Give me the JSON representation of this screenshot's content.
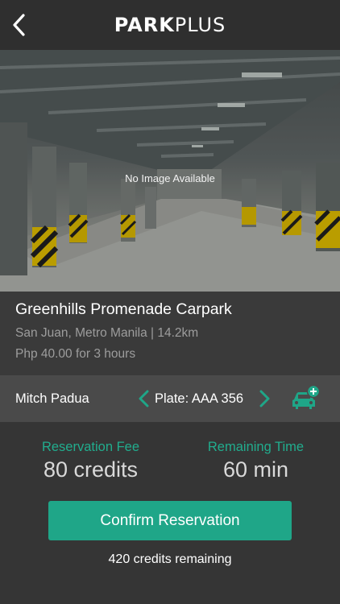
{
  "header": {
    "logo_bold": "PARK",
    "logo_light": "PLUS",
    "back_icon": "chevron-left-icon"
  },
  "hero": {
    "placeholder_text": "No Image Available"
  },
  "venue": {
    "name": "Greenhills Promenade Carpark",
    "location": "San Juan, Metro Manila | 14.2km",
    "rate": "Php 40.00 for 3 hours"
  },
  "vehicle": {
    "user_name": "Mitch Padua",
    "plate_label": "Plate: AAA 356",
    "prev_icon": "chevron-left-icon",
    "next_icon": "chevron-right-icon",
    "add_icon": "add-car-icon"
  },
  "stats": {
    "fee_label": "Reservation Fee",
    "fee_value": "80 credits",
    "time_label": "Remaining Time",
    "time_value": "60 min"
  },
  "actions": {
    "confirm_label": "Confirm Reservation",
    "credits_remaining": "420 credits remaining"
  },
  "colors": {
    "accent": "#1fa688",
    "accent_text": "#21ad8e",
    "background": "#353535",
    "header": "#2f2f2f",
    "row": "#4a4a4a"
  }
}
